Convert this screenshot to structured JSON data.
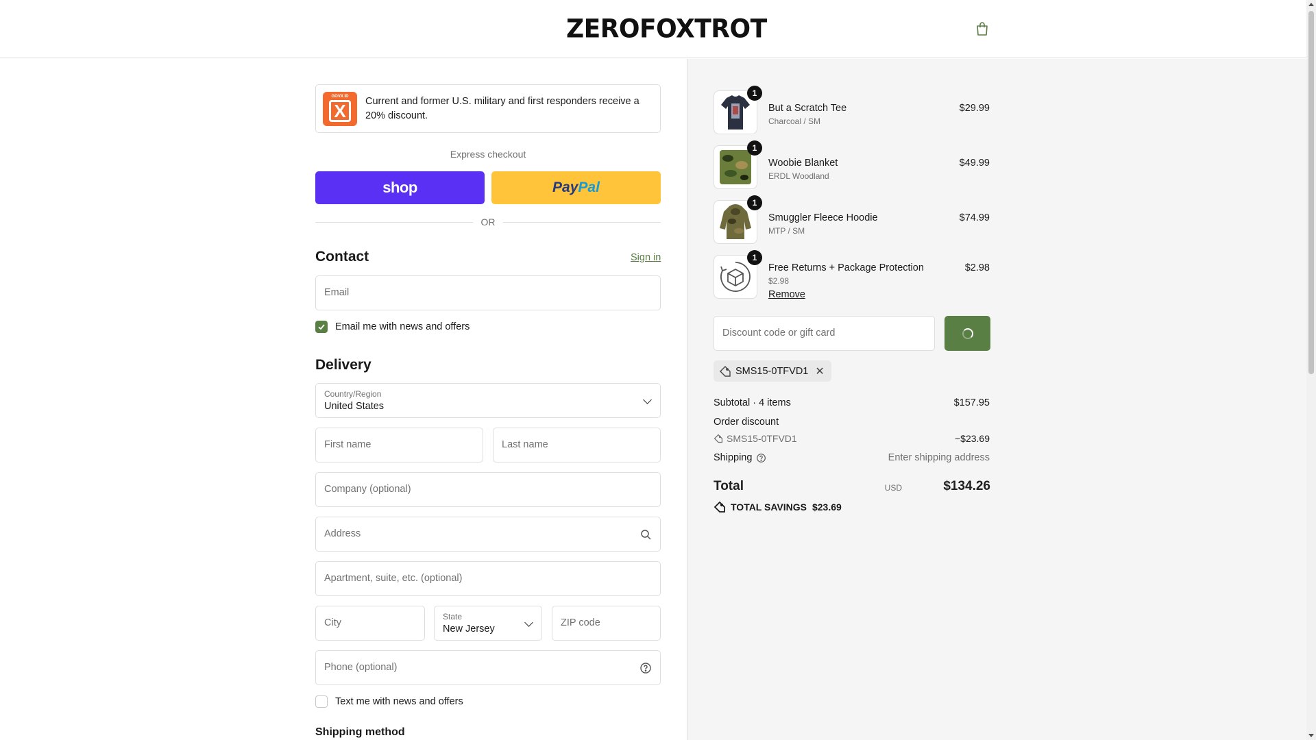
{
  "header": {
    "logo_text_left": "ZERO",
    "logo_text_right": "FOXTROT",
    "cart_icon": "shopping-bag-icon"
  },
  "banner": {
    "logo_top": "GOVX ID",
    "logo_mark": "X",
    "text": "Current and former U.S. military and first responders receive a 20% discount."
  },
  "express": {
    "label": "Express checkout",
    "shop_label": "shop",
    "paypal_label_1": "Pay",
    "paypal_label_2": "Pal",
    "or": "OR"
  },
  "contact": {
    "title": "Contact",
    "sign_in": "Sign in",
    "email_placeholder": "Email",
    "news_checkbox_label": "Email me with news and offers",
    "news_checked": true
  },
  "delivery": {
    "title": "Delivery",
    "country_label": "Country/Region",
    "country_value": "United States",
    "first_name_placeholder": "First name",
    "last_name_placeholder": "Last name",
    "company_placeholder": "Company (optional)",
    "address_placeholder": "Address",
    "apartment_placeholder": "Apartment, suite, etc. (optional)",
    "city_placeholder": "City",
    "state_label": "State",
    "state_value": "New Jersey",
    "zip_placeholder": "ZIP code",
    "phone_placeholder": "Phone (optional)",
    "text_checkbox_label": "Text me with news and offers",
    "text_checked": false
  },
  "shipping_method": {
    "title": "Shipping method"
  },
  "cart": {
    "items": [
      {
        "name": "But a Scratch Tee",
        "variant": "Charcoal / SM",
        "price": "$29.99",
        "qty": "1"
      },
      {
        "name": "Woobie Blanket",
        "variant": "ERDL Woodland",
        "price": "$49.99",
        "qty": "1"
      },
      {
        "name": "Smuggler Fleece Hoodie",
        "variant": "MTP / SM",
        "price": "$74.99",
        "qty": "1"
      },
      {
        "name": "Free Returns + Package Protection",
        "variant": "$2.98",
        "price": "$2.98",
        "qty": "1",
        "remove": "Remove"
      }
    ]
  },
  "discount": {
    "placeholder": "Discount code or gift card",
    "applied_code": "SMS15-0TFVD1"
  },
  "summary": {
    "subtotal_label": "Subtotal · 4 items",
    "subtotal_value": "$157.95",
    "order_discount_label": "Order discount",
    "discount_code": "SMS15-0TFVD1",
    "discount_value": "−$23.69",
    "shipping_label": "Shipping",
    "shipping_value": "Enter shipping address",
    "total_label": "Total",
    "currency": "USD",
    "total_value": "$134.26",
    "savings_label": "TOTAL SAVINGS",
    "savings_value": "$23.69"
  },
  "colors": {
    "accent": "#5a7f45",
    "shop_pay": "#5a31f4",
    "paypal": "#ffc439",
    "govx": "#f26a2e"
  }
}
